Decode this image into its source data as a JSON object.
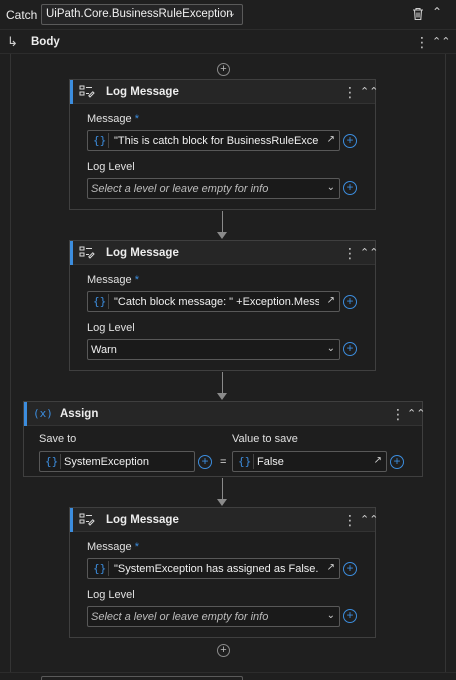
{
  "header": {
    "catch_label": "Catch",
    "exception_type": "UiPath.Core.BusinessRuleException"
  },
  "body_section": {
    "label": "Body"
  },
  "activities": [
    {
      "type": "Log Message",
      "title": "Log Message",
      "message_label": "Message",
      "required_marker": "*",
      "message_value": "\"This is catch block for BusinessRuleExcep",
      "log_level_label": "Log Level",
      "log_level_value": "",
      "log_level_placeholder": "Select a level or leave empty for info"
    },
    {
      "type": "Log Message",
      "title": "Log Message",
      "message_label": "Message",
      "required_marker": "*",
      "message_value": "\"Catch block message: \" +Exception.Mess",
      "log_level_label": "Log Level",
      "log_level_value": "Warn",
      "log_level_placeholder": ""
    },
    {
      "type": "Assign",
      "title": "Assign",
      "save_to_label": "Save to",
      "save_to_value": "SystemException",
      "equals": "=",
      "value_label": "Value to save",
      "value_value": "False"
    },
    {
      "type": "Log Message",
      "title": "Log Message",
      "message_label": "Message",
      "required_marker": "*",
      "message_value": "\"SystemException has assigned as False.\"",
      "log_level_label": "Log Level",
      "log_level_value": "",
      "log_level_placeholder": "Select a level or leave empty for info"
    }
  ],
  "icons": {
    "trash": "trash-icon",
    "collapse": "chevron-up-icon",
    "more": "more-vertical-icon",
    "collapse_all": "double-chevron-up-icon",
    "expression": "expression-braces-icon",
    "add": "plus-circle-icon",
    "dropdown": "chevron-down-icon",
    "expand": "expand-icon",
    "log_message": "log-message-icon",
    "assign": "assign-icon"
  },
  "colors": {
    "accent": "#3c8dde",
    "background": "#1f1f1f",
    "card": "#1e1e1e"
  }
}
